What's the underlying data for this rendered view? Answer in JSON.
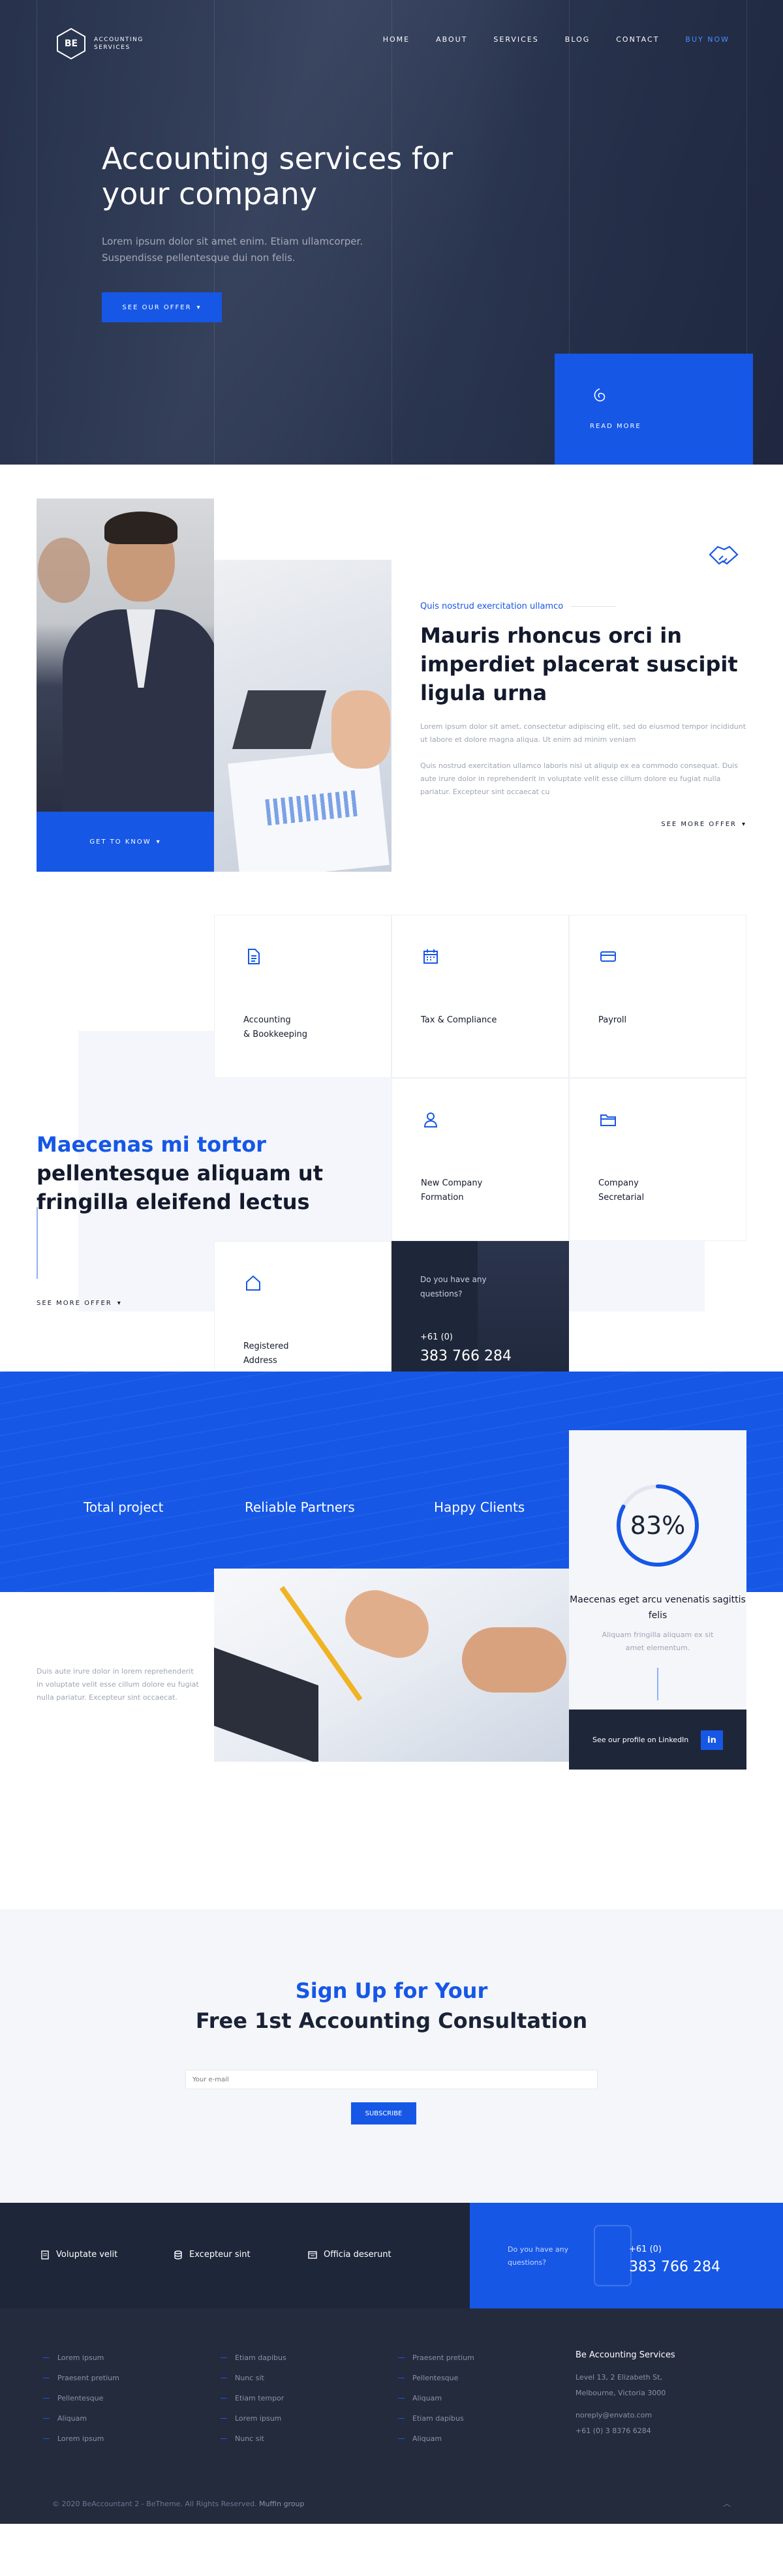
{
  "header": {
    "logo_mark": "BE",
    "logo_line1": "ACCOUNTING",
    "logo_line2": "SERVICES",
    "nav": [
      "HOME",
      "ABOUT",
      "SERVICES",
      "BLOG",
      "CONTACT",
      "BUY NOW"
    ]
  },
  "hero": {
    "title": "Accounting services for your company",
    "text": "Lorem ipsum dolor sit amet enim. Etiam ullamcorper. Suspendisse pellentesque dui non felis.",
    "button": "SEE OUR OFFER",
    "read_more": "READ MORE"
  },
  "about": {
    "button": "GET TO KNOW",
    "eyebrow": "Quis nostrud exercitation ullamco",
    "title": "Mauris rhoncus orci in imperdiet placerat suscipit ligula urna",
    "p1": "Lorem ipsum dolor sit amet, consectetur adipiscing elit, sed do eiusmod tempor incididunt ut labore et dolore magna aliqua. Ut enim ad minim veniam",
    "p2": "Quis nostrud exercitation ullamco laboris nisi ut aliquip ex ea commodo consequat. Duis aute irure dolor in reprehenderit in voluptate velit esse cillum dolore eu fugiat nulla pariatur. Excepteur sint occaecat cu",
    "link": "SEE MORE OFFER"
  },
  "services": {
    "title_blue": "Maecenas mi tortor",
    "title_rest": "pellentesque aliquam ut fringilla eleifend lectus",
    "link": "SEE MORE OFFER",
    "cards": [
      "Accounting\n& Bookkeeping",
      "Tax & Compliance",
      "Payroll",
      "New Company\nFormation",
      "Company\nSecretarial",
      "Registered\nAddress"
    ],
    "call": {
      "question": "Do you have any questions?",
      "line1": "+61 (0)",
      "line2": "383 766 284"
    }
  },
  "stats": {
    "items": [
      "Total project",
      "Reliable Partners",
      "Happy Clients"
    ],
    "percent": "83%",
    "percent_value": 83,
    "card_title": "Maecenas eget arcu venenatis sagittis felis",
    "card_text": "Aliquam fringilla aliquam ex sit amet elementum.",
    "linkedin_text": "See our profile on LinkedIn",
    "linkedin_badge": "in",
    "desc": "Duis aute irure dolor in lorem reprehenderit in voluptate velit esse cillum dolore eu fugiat nulla pariatur. Excepteur sint occaecat.",
    "accent": "#1657e6"
  },
  "signup": {
    "title_blue": "Sign Up for Your",
    "title_rest": "Free 1st Accounting Consultation",
    "placeholder": "Your e-mail",
    "button": "SUBSCRIBE"
  },
  "contact_bar": {
    "features": [
      "Voluptate velit",
      "Excepteur sint",
      "Officia deserunt"
    ],
    "question": "Do you have any questions?",
    "line1": "+61 (0)",
    "line2": "383 766 284"
  },
  "footer": {
    "col1": [
      "Lorem ipsum",
      "Praesent pretium",
      "Pellentesque",
      "Aliquam",
      "Lorem ipsum"
    ],
    "col2": [
      "Etiam dapibus",
      "Nunc sit",
      "Etiam tempor",
      "Lorem ipsum",
      "Nunc sit"
    ],
    "col3": [
      "Praesent pretium",
      "Pellentesque",
      "Aliquam",
      "Etiam dapibus",
      "Aliquam"
    ],
    "company": "Be Accounting Services",
    "address1": "Level 13, 2 Elizabeth St,",
    "address2": "Melbourne, Victoria 3000",
    "email": "noreply@envato.com",
    "phone": "+61 (0) 3 8376 6284",
    "copyright": "© 2020 BeAccountant 2 - BeTheme. All Rights Reserved.",
    "credit": "Muffin group"
  }
}
